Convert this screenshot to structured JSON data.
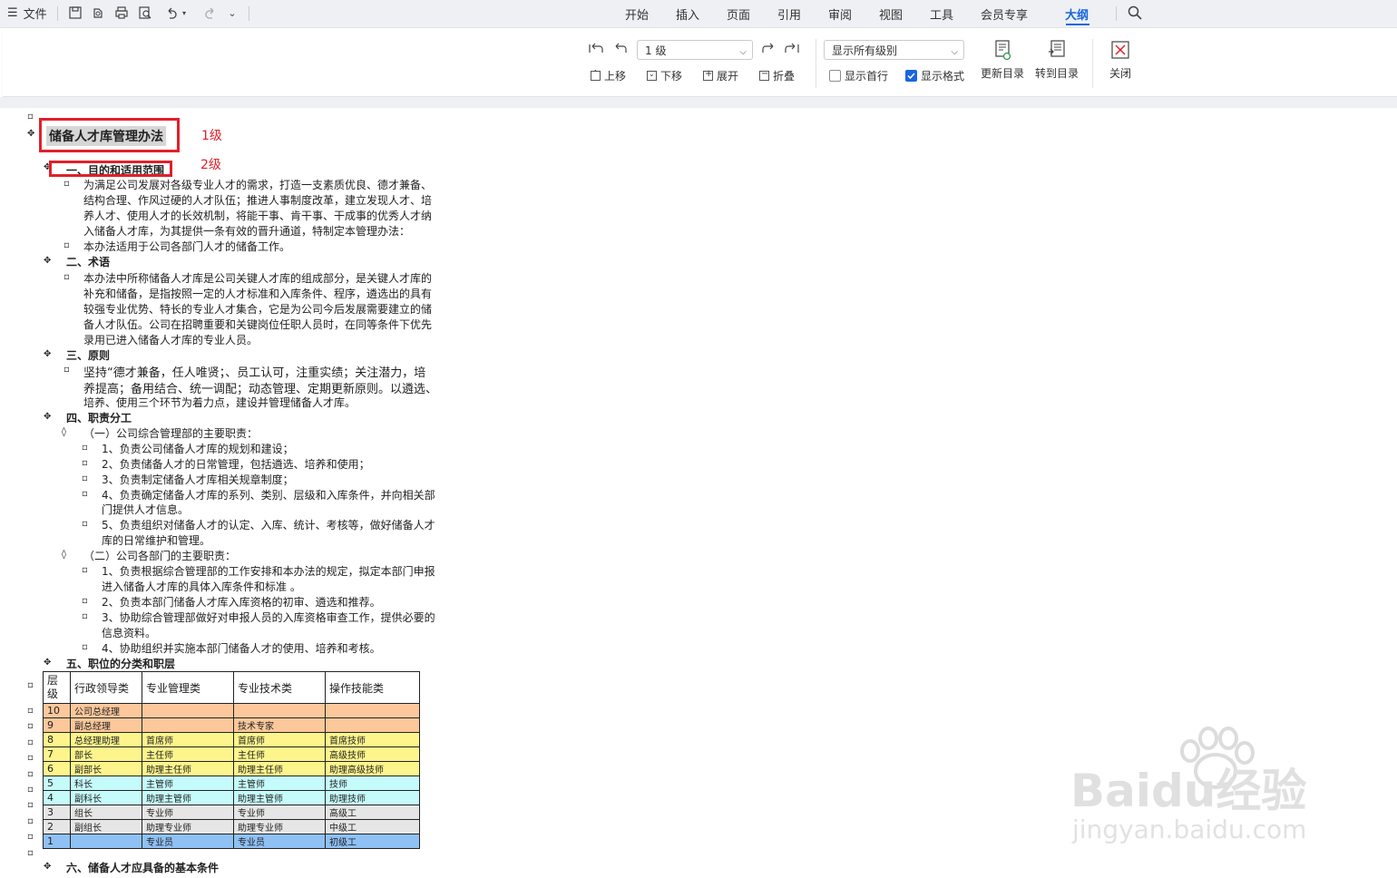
{
  "menubar": {
    "file_label": "文件",
    "tabs": [
      "开始",
      "插入",
      "页面",
      "引用",
      "审阅",
      "视图",
      "工具",
      "会员专享",
      "大纲"
    ],
    "active_tab": "大纲"
  },
  "ribbon": {
    "level_select": "1 级",
    "move_up": "上移",
    "move_down": "下移",
    "expand": "展开",
    "collapse": "折叠",
    "show_level_select": "显示所有级别",
    "show_first_line": "显示首行",
    "show_format": "显示格式",
    "show_format_checked": true,
    "show_first_line_checked": false,
    "update_toc": "更新目录",
    "goto_toc": "转到目录",
    "close": "关闭"
  },
  "annotations": {
    "level1": "1级",
    "level2": "2级"
  },
  "document": {
    "title": "储备人才库管理办法",
    "s1_heading": "一、目的和适用范围",
    "s1_p1": [
      "为满足公司发展对各级专业人才的需求，打造一支素质优良、德才兼备、",
      "结构合理、作风过硬的人才队伍；推进人事制度改革，建立发现人才、培",
      "养人才、使用人才的长效机制，将能干事、肯干事、干成事的优秀人才纳",
      "入储备人才库，为其提供一条有效的晋升通道，特制定本管理办法："
    ],
    "s1_p2": "本办法适用于公司各部门人才的储备工作。",
    "s2_heading": "二、术语",
    "s2_p1": [
      "本办法中所称储备人才库是公司关键人才库的组成部分，是关键人才库的",
      "补充和储备，是指按照一定的人才标准和入库条件、程序，遴选出的具有",
      "较强专业优势、特长的专业人才集合，它是为公司今后发展需要建立的储",
      "备人才队伍。公司在招聘重要和关键岗位任职人员时，在同等条件下优先",
      "录用已进入储备人才库的专业人员。"
    ],
    "s3_heading": "三、原则",
    "s3_p1": [
      "坚持“德才兼备，任人唯贤；、员工认可，注重实绩；关注潜力，培",
      "养提高；备用结合、统一调配；动态管理、定期更新原则。以遴选、",
      "培养、使用三个环节为着力点，建设并管理储备人才库。"
    ],
    "s4_heading": "四、职责分工",
    "s4_sub1": "（一）公司综合管理部的主要职责：",
    "s4_sub1_items": [
      [
        "1、负责公司储备人才库的规划和建设；"
      ],
      [
        "2、负责储备人才的日常管理，包括遴选、培养和使用；"
      ],
      [
        "3、负责制定储备人才库相关规章制度；"
      ],
      [
        "4、负责确定储备人才库的系列、类别、层级和入库条件，并向相关部",
        "门提供人才信息。"
      ],
      [
        "5、负责组织对储备人才的认定、入库、统计、考核等，做好储备人才",
        "库的日常维护和管理。"
      ]
    ],
    "s4_sub2": "（二）公司各部门的主要职责：",
    "s4_sub2_items": [
      [
        "1、负责根据综合管理部的工作安排和本办法的规定，拟定本部门申报",
        "进入储备人才库的具体入库条件和标准 。"
      ],
      [
        "2、负责本部门储备人才库入库资格的初审、遴选和推荐。"
      ],
      [
        "3、协助综合管理部做好对申报人员的入库资格审查工作，提供必要的",
        "信息资料。"
      ],
      [
        "4、协助组织并实施本部门储备人才的使用、培养和考核。"
      ]
    ],
    "s5_heading": "五、职位的分类和职层",
    "table": {
      "headers": [
        "层\n级",
        "行政领导类",
        "专业管理类",
        "专业技术类",
        "操作技能类"
      ],
      "rows": [
        {
          "level": "10",
          "c1": "公司总经理",
          "c2": "",
          "c3": "",
          "c4": "",
          "color": "#fcc89b"
        },
        {
          "level": "9",
          "c1": "副总经理",
          "c2": "",
          "c3": "技术专家",
          "c4": "",
          "color": "#fcc89b"
        },
        {
          "level": "8",
          "c1": "总经理助理",
          "c2": "首席师",
          "c3": "首席师",
          "c4": "首席技师",
          "color": "#fdf58c"
        },
        {
          "level": "7",
          "c1": "部长",
          "c2": "主任师",
          "c3": "主任师",
          "c4": "高级技师",
          "color": "#fdf58c"
        },
        {
          "level": "6",
          "c1": "副部长",
          "c2": "助理主任师",
          "c3": "助理主任师",
          "c4": "助理高级技师",
          "color": "#fdf58c"
        },
        {
          "level": "5",
          "c1": "科长",
          "c2": "主管师",
          "c3": "主管师",
          "c4": "技师",
          "color": "#c6fbfb"
        },
        {
          "level": "4",
          "c1": "副科长",
          "c2": "助理主管师",
          "c3": "助理主管师",
          "c4": "助理技师",
          "color": "#c6fbfb"
        },
        {
          "level": "3",
          "c1": "组长",
          "c2": "专业师",
          "c3": "专业师",
          "c4": "高级工",
          "color": "#e6e6e6"
        },
        {
          "level": "2",
          "c1": "副组长",
          "c2": "助理专业师",
          "c3": "助理专业师",
          "c4": "中级工",
          "color": "#e6e6e6"
        },
        {
          "level": "1",
          "c1": "",
          "c2": "专业员",
          "c3": "专业员",
          "c4": "初级工",
          "color": "#8fc1f5"
        }
      ]
    },
    "s6_heading": "六、储备人才应具备的基本条件"
  },
  "watermark": {
    "brand": "Baidu经验",
    "url": "jingyan.baidu.com"
  }
}
